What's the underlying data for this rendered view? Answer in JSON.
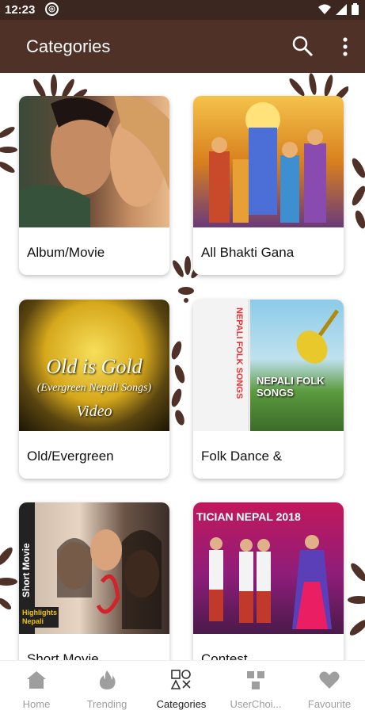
{
  "status_bar": {
    "time": "12:23",
    "notification_icon": "app-notification-icon"
  },
  "app_bar": {
    "title": "Categories",
    "search_icon": "search-icon",
    "menu_icon": "more-vert-icon"
  },
  "colors": {
    "primary": "#4f3128",
    "status": "#3b2620",
    "active_nav": "#222222",
    "inactive_nav": "#9e9e9e"
  },
  "categories": [
    {
      "label": "Album/Movie",
      "thumb_text": ""
    },
    {
      "label": "All Bhakti Gana",
      "thumb_text": ""
    },
    {
      "label": "Old/Evergreen",
      "thumb_text": "Old is Gold",
      "thumb_sub": "(Evergreen Nepali Songs)",
      "thumb_sub2": "Video"
    },
    {
      "label": "Folk Dance &",
      "thumb_text": "NEPALI FOLK SONGS",
      "thumb_side": "NEPALI FOLK SONGS"
    },
    {
      "label": "Short Movie",
      "thumb_text": "Short Movie",
      "thumb_sub": "Highlights Nepali"
    },
    {
      "label": "Contest",
      "thumb_text": "TICIAN NEPAL 2018"
    }
  ],
  "bottom_nav": [
    {
      "label": "Home",
      "icon": "home-icon"
    },
    {
      "label": "Trending",
      "icon": "fire-icon"
    },
    {
      "label": "Categories",
      "icon": "categories-icon",
      "active": true
    },
    {
      "label": "UserChoi...",
      "icon": "user-choice-icon"
    },
    {
      "label": "Favourite",
      "icon": "heart-icon"
    }
  ]
}
